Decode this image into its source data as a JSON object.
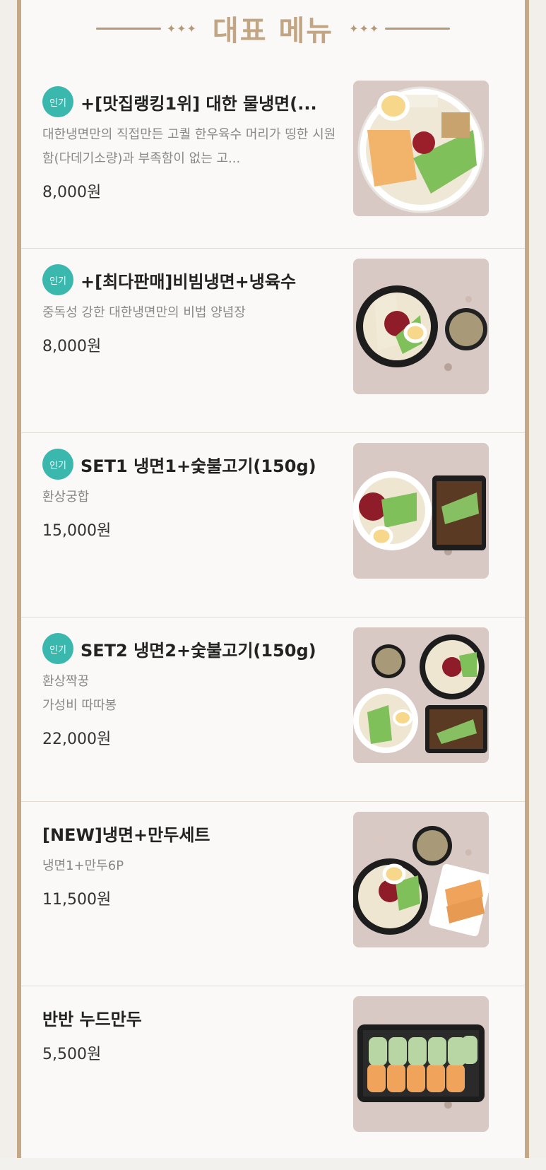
{
  "header": {
    "title": "대표 메뉴",
    "ornament": "✦✦✦"
  },
  "badge_label": "인기",
  "items": [
    {
      "name": "+[맛집랭킹1위] 대한 물냉면(...",
      "desc": "대한냉면만의 직접만든 고퀄 한우육수 머리가 띵한 시원함(다데기소량)과 부족함이 없는 고...",
      "price": "8,000원",
      "popular": true
    },
    {
      "name": "+[최다판매]비빔냉면+냉육수",
      "desc": "중독성 강한 대한냉면만의 비법 양념장",
      "price": "8,000원",
      "popular": true
    },
    {
      "name": "SET1 냉면1+숯불고기(150g)",
      "desc": "환상궁합",
      "price": "15,000원",
      "popular": true
    },
    {
      "name": "SET2 냉면2+숯불고기(150g)",
      "desc": "환상짝꿍",
      "desc_line2": "가성비 따따봉",
      "price": "22,000원",
      "popular": true
    },
    {
      "name": "[NEW]냉면+만두세트",
      "desc": "냉면1+만두6P",
      "price": "11,500원",
      "popular": false
    },
    {
      "name": "반반 누드만두",
      "desc": "",
      "price": "5,500원",
      "popular": false
    }
  ]
}
